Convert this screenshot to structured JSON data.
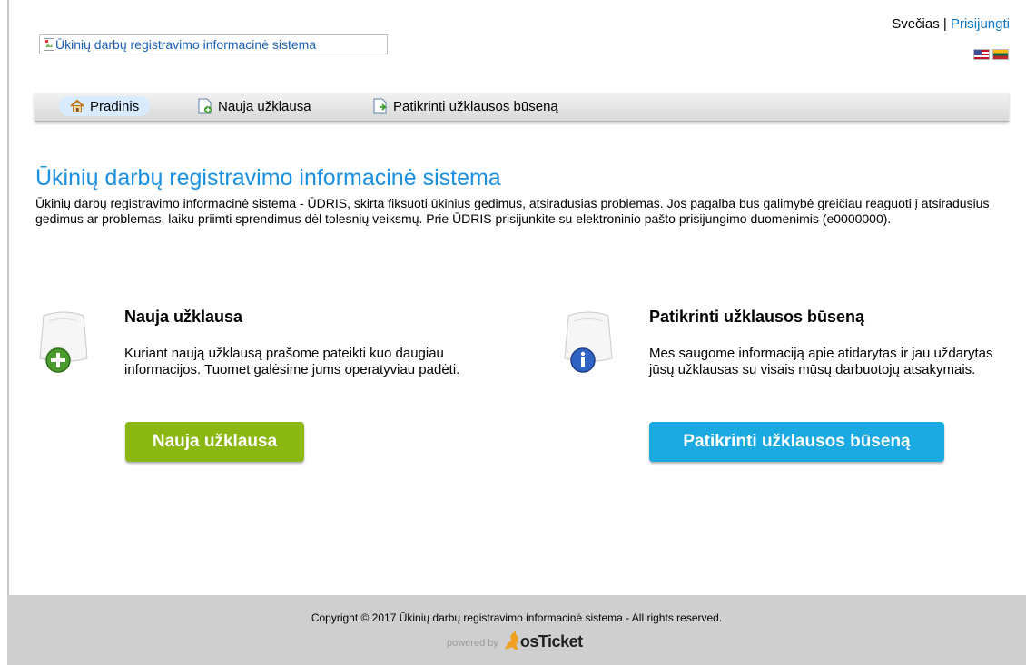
{
  "header": {
    "logo_alt": "Ūkinių darbų registravimo informacinė sistema",
    "user_label": "Svečias",
    "separator": "|",
    "login_link": "Prisijungti",
    "languages": [
      "English (US)",
      "Lietuvių"
    ]
  },
  "nav": {
    "items": [
      {
        "label": "Pradinis",
        "icon": "home-icon",
        "active": true
      },
      {
        "label": "Nauja užklausa",
        "icon": "new-ticket-icon",
        "active": false
      },
      {
        "label": "Patikrinti užklausos būseną",
        "icon": "ticket-status-icon",
        "active": false
      }
    ]
  },
  "main": {
    "title": "Ūkinių darbų registravimo informacinė sistema",
    "intro": "Ūkinių darbų registravimo informacinė sistema - ŪDRIS, skirta fiksuoti ūkinius gedimus, atsiradusias problemas. Jos pagalba bus galimybė greičiau reaguoti į atsiradusius gedimus ar problemas, laiku priimti sprendimus dėl tolesnių veiksmų. Prie ŪDRIS prisijunkite su elektroninio pašto prisijungimo duomenimis (e0000000).",
    "cards": [
      {
        "title": "Nauja užklausa",
        "text": "Kuriant naują užklausą prašome pateikti kuo daugiau informacijos. Tuomet galėsime jums operatyviau padėti.",
        "button": "Nauja užklausa",
        "icon": "new-ticket-large-icon",
        "color": "#8ab712"
      },
      {
        "title": "Patikrinti užklausos būseną",
        "text": "Mes saugome informaciją apie atidarytas ir jau uždarytas jūsų užklausas su visais mūsų darbuotojų atsakymais.",
        "button": "Patikrinti užklausos būseną",
        "icon": "check-status-large-icon",
        "color": "#1aa9e0"
      }
    ]
  },
  "footer": {
    "copyright": "Copyright © 2017 Ūkinių darbų registravimo informacinė sistema - All rights reserved.",
    "powered_by": "powered by",
    "brand": "osTicket"
  },
  "colors": {
    "title_blue": "#1b8fe0",
    "link_blue": "#0b78c6",
    "footer_bg": "#cfcfcf",
    "nav_active_bg": "#d9ecff"
  }
}
